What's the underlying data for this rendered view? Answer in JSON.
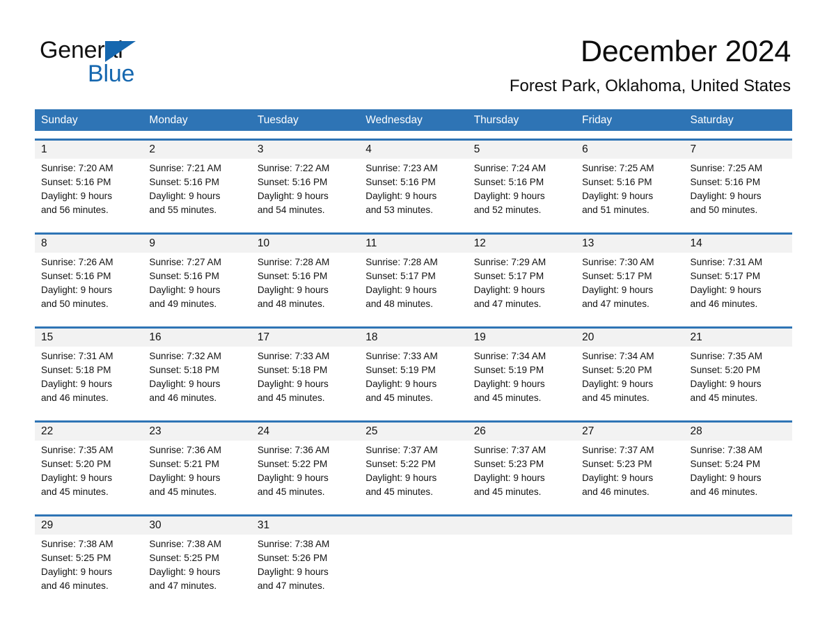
{
  "logo": {
    "word_one": "General",
    "word_two": "Blue",
    "triangle_color": "#1567AF",
    "text_color": "#111111"
  },
  "header": {
    "title": "December 2024",
    "subtitle": "Forest Park, Oklahoma, United States"
  },
  "theme": {
    "header_blue": "#2E74B5",
    "row_band_gray": "#F2F2F2",
    "text_black": "#111111",
    "header_text": "#FFFFFF"
  },
  "calendar": {
    "weekdays": [
      "Sunday",
      "Monday",
      "Tuesday",
      "Wednesday",
      "Thursday",
      "Friday",
      "Saturday"
    ],
    "weeks": [
      [
        {
          "day": "1",
          "sunrise": "Sunrise: 7:20 AM",
          "sunset": "Sunset: 5:16 PM",
          "daylight_line1": "Daylight: 9 hours",
          "daylight_line2": "and 56 minutes."
        },
        {
          "day": "2",
          "sunrise": "Sunrise: 7:21 AM",
          "sunset": "Sunset: 5:16 PM",
          "daylight_line1": "Daylight: 9 hours",
          "daylight_line2": "and 55 minutes."
        },
        {
          "day": "3",
          "sunrise": "Sunrise: 7:22 AM",
          "sunset": "Sunset: 5:16 PM",
          "daylight_line1": "Daylight: 9 hours",
          "daylight_line2": "and 54 minutes."
        },
        {
          "day": "4",
          "sunrise": "Sunrise: 7:23 AM",
          "sunset": "Sunset: 5:16 PM",
          "daylight_line1": "Daylight: 9 hours",
          "daylight_line2": "and 53 minutes."
        },
        {
          "day": "5",
          "sunrise": "Sunrise: 7:24 AM",
          "sunset": "Sunset: 5:16 PM",
          "daylight_line1": "Daylight: 9 hours",
          "daylight_line2": "and 52 minutes."
        },
        {
          "day": "6",
          "sunrise": "Sunrise: 7:25 AM",
          "sunset": "Sunset: 5:16 PM",
          "daylight_line1": "Daylight: 9 hours",
          "daylight_line2": "and 51 minutes."
        },
        {
          "day": "7",
          "sunrise": "Sunrise: 7:25 AM",
          "sunset": "Sunset: 5:16 PM",
          "daylight_line1": "Daylight: 9 hours",
          "daylight_line2": "and 50 minutes."
        }
      ],
      [
        {
          "day": "8",
          "sunrise": "Sunrise: 7:26 AM",
          "sunset": "Sunset: 5:16 PM",
          "daylight_line1": "Daylight: 9 hours",
          "daylight_line2": "and 50 minutes."
        },
        {
          "day": "9",
          "sunrise": "Sunrise: 7:27 AM",
          "sunset": "Sunset: 5:16 PM",
          "daylight_line1": "Daylight: 9 hours",
          "daylight_line2": "and 49 minutes."
        },
        {
          "day": "10",
          "sunrise": "Sunrise: 7:28 AM",
          "sunset": "Sunset: 5:16 PM",
          "daylight_line1": "Daylight: 9 hours",
          "daylight_line2": "and 48 minutes."
        },
        {
          "day": "11",
          "sunrise": "Sunrise: 7:28 AM",
          "sunset": "Sunset: 5:17 PM",
          "daylight_line1": "Daylight: 9 hours",
          "daylight_line2": "and 48 minutes."
        },
        {
          "day": "12",
          "sunrise": "Sunrise: 7:29 AM",
          "sunset": "Sunset: 5:17 PM",
          "daylight_line1": "Daylight: 9 hours",
          "daylight_line2": "and 47 minutes."
        },
        {
          "day": "13",
          "sunrise": "Sunrise: 7:30 AM",
          "sunset": "Sunset: 5:17 PM",
          "daylight_line1": "Daylight: 9 hours",
          "daylight_line2": "and 47 minutes."
        },
        {
          "day": "14",
          "sunrise": "Sunrise: 7:31 AM",
          "sunset": "Sunset: 5:17 PM",
          "daylight_line1": "Daylight: 9 hours",
          "daylight_line2": "and 46 minutes."
        }
      ],
      [
        {
          "day": "15",
          "sunrise": "Sunrise: 7:31 AM",
          "sunset": "Sunset: 5:18 PM",
          "daylight_line1": "Daylight: 9 hours",
          "daylight_line2": "and 46 minutes."
        },
        {
          "day": "16",
          "sunrise": "Sunrise: 7:32 AM",
          "sunset": "Sunset: 5:18 PM",
          "daylight_line1": "Daylight: 9 hours",
          "daylight_line2": "and 46 minutes."
        },
        {
          "day": "17",
          "sunrise": "Sunrise: 7:33 AM",
          "sunset": "Sunset: 5:18 PM",
          "daylight_line1": "Daylight: 9 hours",
          "daylight_line2": "and 45 minutes."
        },
        {
          "day": "18",
          "sunrise": "Sunrise: 7:33 AM",
          "sunset": "Sunset: 5:19 PM",
          "daylight_line1": "Daylight: 9 hours",
          "daylight_line2": "and 45 minutes."
        },
        {
          "day": "19",
          "sunrise": "Sunrise: 7:34 AM",
          "sunset": "Sunset: 5:19 PM",
          "daylight_line1": "Daylight: 9 hours",
          "daylight_line2": "and 45 minutes."
        },
        {
          "day": "20",
          "sunrise": "Sunrise: 7:34 AM",
          "sunset": "Sunset: 5:20 PM",
          "daylight_line1": "Daylight: 9 hours",
          "daylight_line2": "and 45 minutes."
        },
        {
          "day": "21",
          "sunrise": "Sunrise: 7:35 AM",
          "sunset": "Sunset: 5:20 PM",
          "daylight_line1": "Daylight: 9 hours",
          "daylight_line2": "and 45 minutes."
        }
      ],
      [
        {
          "day": "22",
          "sunrise": "Sunrise: 7:35 AM",
          "sunset": "Sunset: 5:20 PM",
          "daylight_line1": "Daylight: 9 hours",
          "daylight_line2": "and 45 minutes."
        },
        {
          "day": "23",
          "sunrise": "Sunrise: 7:36 AM",
          "sunset": "Sunset: 5:21 PM",
          "daylight_line1": "Daylight: 9 hours",
          "daylight_line2": "and 45 minutes."
        },
        {
          "day": "24",
          "sunrise": "Sunrise: 7:36 AM",
          "sunset": "Sunset: 5:22 PM",
          "daylight_line1": "Daylight: 9 hours",
          "daylight_line2": "and 45 minutes."
        },
        {
          "day": "25",
          "sunrise": "Sunrise: 7:37 AM",
          "sunset": "Sunset: 5:22 PM",
          "daylight_line1": "Daylight: 9 hours",
          "daylight_line2": "and 45 minutes."
        },
        {
          "day": "26",
          "sunrise": "Sunrise: 7:37 AM",
          "sunset": "Sunset: 5:23 PM",
          "daylight_line1": "Daylight: 9 hours",
          "daylight_line2": "and 45 minutes."
        },
        {
          "day": "27",
          "sunrise": "Sunrise: 7:37 AM",
          "sunset": "Sunset: 5:23 PM",
          "daylight_line1": "Daylight: 9 hours",
          "daylight_line2": "and 46 minutes."
        },
        {
          "day": "28",
          "sunrise": "Sunrise: 7:38 AM",
          "sunset": "Sunset: 5:24 PM",
          "daylight_line1": "Daylight: 9 hours",
          "daylight_line2": "and 46 minutes."
        }
      ],
      [
        {
          "day": "29",
          "sunrise": "Sunrise: 7:38 AM",
          "sunset": "Sunset: 5:25 PM",
          "daylight_line1": "Daylight: 9 hours",
          "daylight_line2": "and 46 minutes."
        },
        {
          "day": "30",
          "sunrise": "Sunrise: 7:38 AM",
          "sunset": "Sunset: 5:25 PM",
          "daylight_line1": "Daylight: 9 hours",
          "daylight_line2": "and 47 minutes."
        },
        {
          "day": "31",
          "sunrise": "Sunrise: 7:38 AM",
          "sunset": "Sunset: 5:26 PM",
          "daylight_line1": "Daylight: 9 hours",
          "daylight_line2": "and 47 minutes."
        },
        {
          "day": "",
          "sunrise": "",
          "sunset": "",
          "daylight_line1": "",
          "daylight_line2": ""
        },
        {
          "day": "",
          "sunrise": "",
          "sunset": "",
          "daylight_line1": "",
          "daylight_line2": ""
        },
        {
          "day": "",
          "sunrise": "",
          "sunset": "",
          "daylight_line1": "",
          "daylight_line2": ""
        },
        {
          "day": "",
          "sunrise": "",
          "sunset": "",
          "daylight_line1": "",
          "daylight_line2": ""
        }
      ]
    ]
  }
}
